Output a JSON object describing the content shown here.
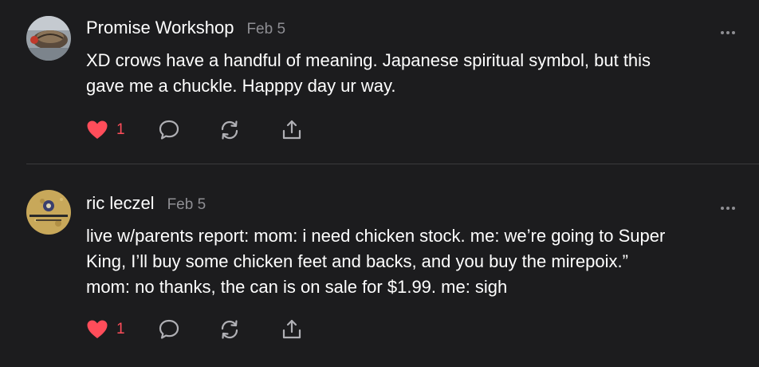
{
  "posts": [
    {
      "author": "Promise Workshop",
      "date": "Feb 5",
      "body": "XD crows have a handful of meaning. Japanese spiritual symbol, but this\ngave me a chuckle. Happpy day ur way.",
      "likes": "1",
      "icons": [
        "heart-icon",
        "comment-icon",
        "restack-icon",
        "share-icon",
        "more-icon"
      ]
    },
    {
      "author": "ric leczel",
      "date": "Feb 5",
      "body": "live w/parents report: mom: i need chicken stock. me: we’re going to Super\nKing, I’ll buy some chicken feet and backs, and you buy the mirepoix.”\nmom: no thanks, the can is on sale for $1.99. me: sigh",
      "likes": "1",
      "icons": [
        "heart-icon",
        "comment-icon",
        "restack-icon",
        "share-icon",
        "more-icon"
      ]
    }
  ],
  "colors": {
    "background": "#1c1c1e",
    "text": "#ffffff",
    "muted": "#8e8e93",
    "like": "#ff4d5a",
    "icon": "#b0b0b5",
    "divider": "#3a3a3c"
  }
}
